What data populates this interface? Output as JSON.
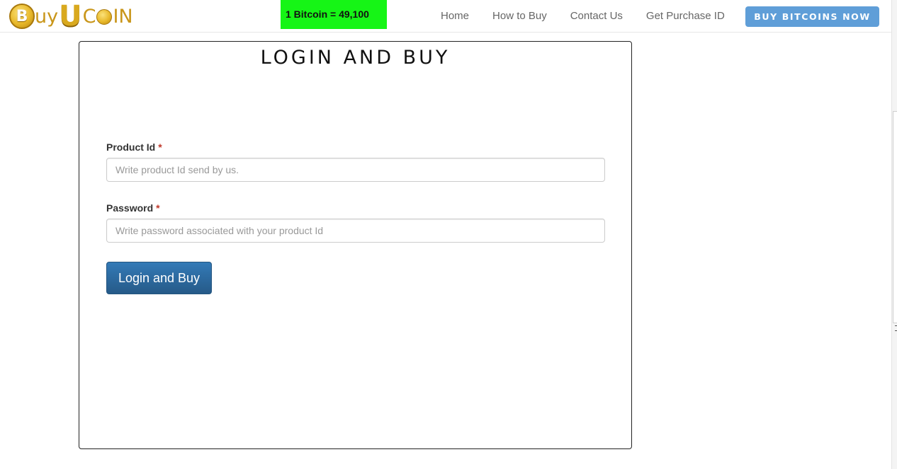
{
  "header": {
    "logo": {
      "text_before": "uy",
      "text_after": "IN"
    },
    "price_badge": "1 Bitcoin = 49,100",
    "nav": [
      {
        "label": "Home"
      },
      {
        "label": "How to Buy"
      },
      {
        "label": "Contact Us"
      },
      {
        "label": "Get Purchase ID"
      }
    ],
    "buy_button_label": "BUY BITCOINS NOW"
  },
  "panel": {
    "title": "LOGIN AND BUY",
    "product_id": {
      "label": "Product Id",
      "required_mark": "*",
      "value": "",
      "placeholder": "Write product Id send by us."
    },
    "password": {
      "label": "Password",
      "required_mark": "*",
      "value": "",
      "placeholder": "Write password associated with your product Id"
    },
    "submit_label": "Login and Buy"
  },
  "colors": {
    "price_badge_bg": "#16f516",
    "buy_button_bg": "#5f9ed8",
    "login_button_bg": "#2c6ca3",
    "logo_gold": "#c9961a",
    "required_mark": "#c0392b"
  }
}
